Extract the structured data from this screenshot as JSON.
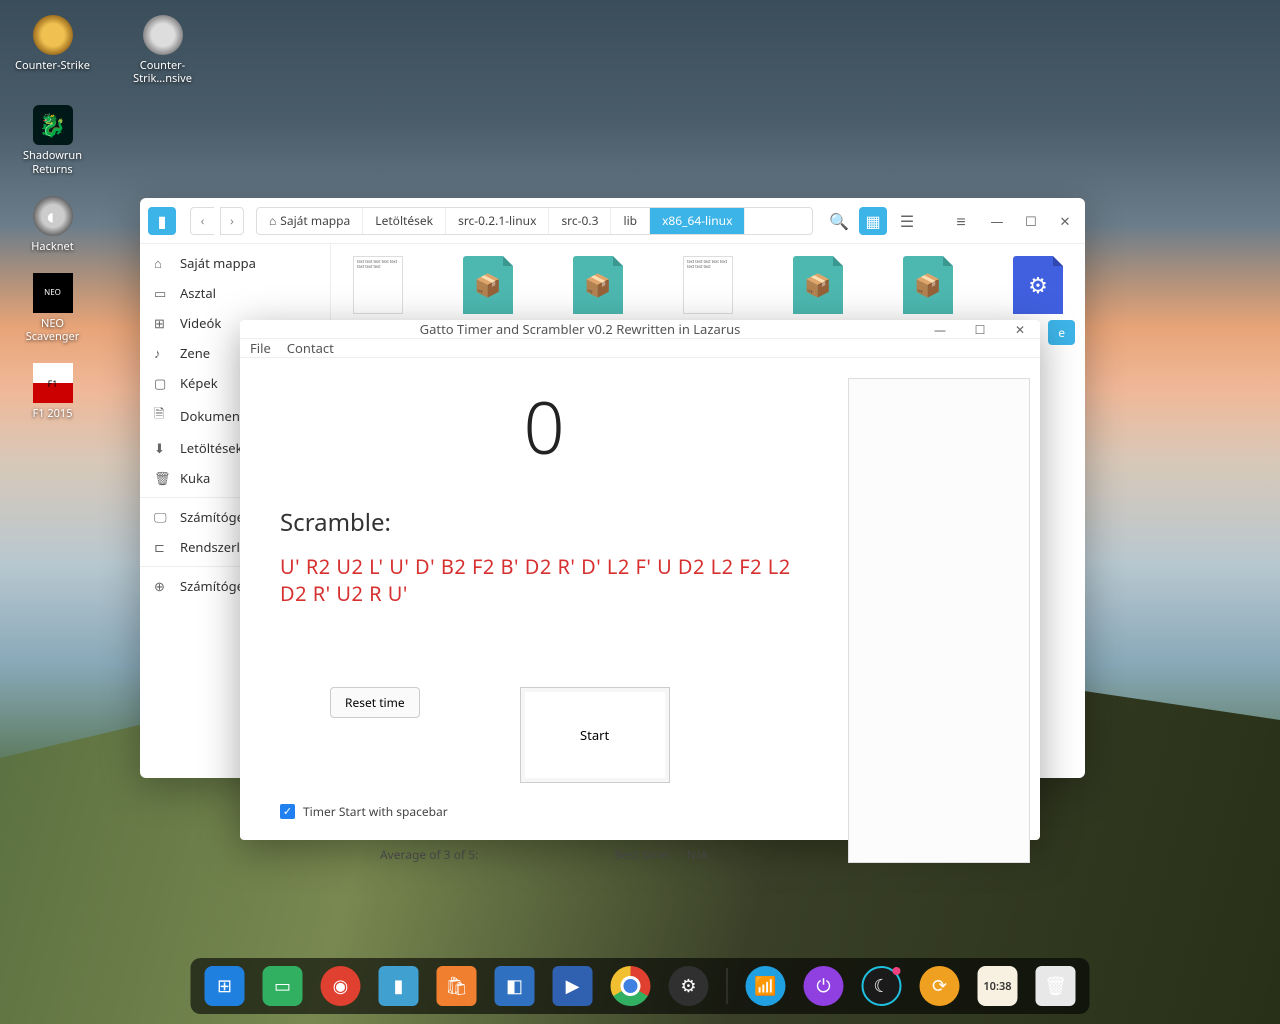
{
  "desktop_icons": {
    "cs": "Counter-Strike",
    "csgo": "Counter-Strik...nsive",
    "shadowrun": "Shadowrun Returns",
    "hacknet": "Hacknet",
    "neo": "NEO Scavenger",
    "f1": "F1 2015"
  },
  "file_manager": {
    "breadcrumb": [
      "Saját mappa",
      "Letöltések",
      "src-0.2.1-linux",
      "src-0.3",
      "lib",
      "x86_64-linux"
    ],
    "sidebar": {
      "home": "Saját mappa",
      "desktop": "Asztal",
      "videos": "Videók",
      "music": "Zene",
      "pictures": "Képek",
      "documents": "Dokumentu",
      "downloads": "Letöltések",
      "trash": "Kuka",
      "computer": "Számítógép",
      "system": "Rendszerlen",
      "computer2": "Számítógé..."
    },
    "open_button": "e"
  },
  "timer": {
    "title": "Gatto Timer and Scrambler v0.2 Rewritten in Lazarus",
    "menu": {
      "file": "File",
      "contact": "Contact"
    },
    "display": "0",
    "scramble_label": "Scramble:",
    "scramble": "U' R2 U2 L' U' D' B2 F2 B' D2 R' D' L2 F' U D2 L2 F2 L2 D2 R' U2 R U'",
    "reset_button": "Reset time",
    "start_button": "Start",
    "checkbox_label": "Timer Start with spacebar",
    "avg_label": "Average of 3 of 5:",
    "avg_value": "",
    "best_label": "Best time:",
    "best_value": "N/A"
  },
  "dock": {
    "clock": "10:38"
  }
}
